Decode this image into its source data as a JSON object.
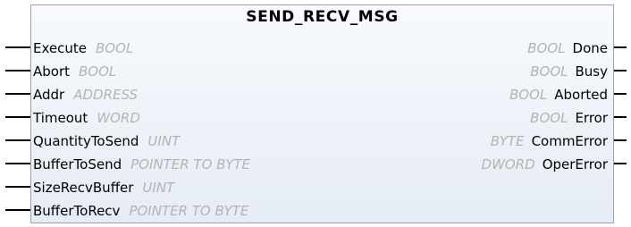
{
  "block": {
    "title": "SEND_RECV_MSG",
    "inputs": [
      {
        "name": "Execute",
        "type": "BOOL"
      },
      {
        "name": "Abort",
        "type": "BOOL"
      },
      {
        "name": "Addr",
        "type": "ADDRESS"
      },
      {
        "name": "Timeout",
        "type": "WORD"
      },
      {
        "name": "QuantityToSend",
        "type": "UINT"
      },
      {
        "name": "BufferToSend",
        "type": "POINTER TO BYTE"
      },
      {
        "name": "SizeRecvBuffer",
        "type": "UINT"
      },
      {
        "name": "BufferToRecv",
        "type": "POINTER TO BYTE"
      }
    ],
    "outputs": [
      {
        "name": "Done",
        "type": "BOOL"
      },
      {
        "name": "Busy",
        "type": "BOOL"
      },
      {
        "name": "Aborted",
        "type": "BOOL"
      },
      {
        "name": "Error",
        "type": "BOOL"
      },
      {
        "name": "CommError",
        "type": "BYTE"
      },
      {
        "name": "OperError",
        "type": "DWORD"
      }
    ]
  }
}
